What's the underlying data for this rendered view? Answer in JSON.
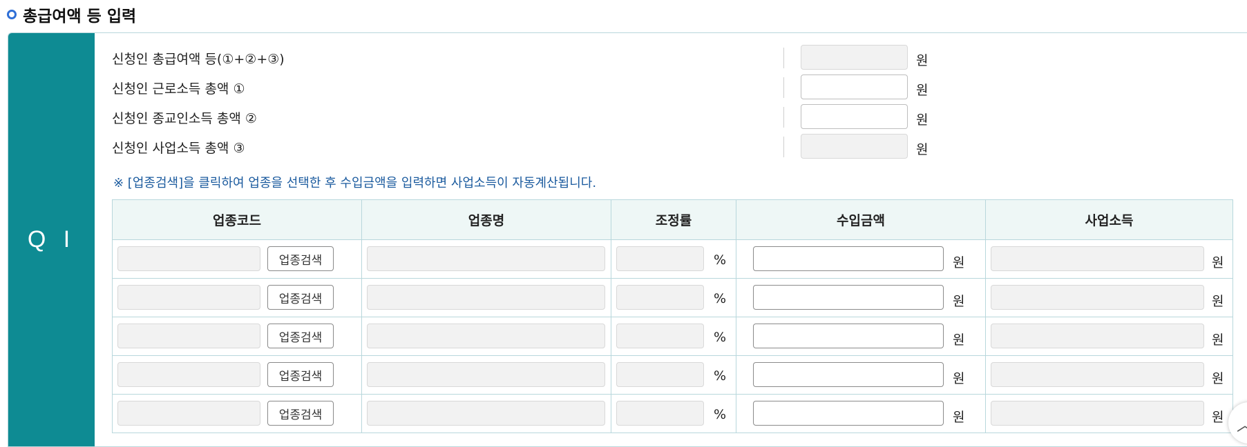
{
  "section": {
    "title": "총급여액 등 입력"
  },
  "side_label": "Q I",
  "income_rows": [
    {
      "label": "신청인 총급여액 등(①+②+③)",
      "value": "",
      "readonly": true,
      "unit": "원"
    },
    {
      "label": "신청인 근로소득 총액 ①",
      "value": "",
      "readonly": false,
      "unit": "원"
    },
    {
      "label": "신청인 종교인소득 총액 ②",
      "value": "",
      "readonly": false,
      "unit": "원"
    },
    {
      "label": "신청인 사업소득 총액 ③",
      "value": "",
      "readonly": true,
      "unit": "원"
    }
  ],
  "notice": "※ [업종검색]을 클릭하여 업종을 선택한 후 수입금액을 입력하면 사업소득이 자동계산됩니다.",
  "table": {
    "headers": [
      "업종코드",
      "업종명",
      "조정률",
      "수입금액",
      "사업소득"
    ],
    "search_button_label": "업종검색",
    "percent_unit": "%",
    "won_unit": "원",
    "rows": [
      {
        "code": "",
        "name": "",
        "rate": "",
        "income": "",
        "business_income": ""
      },
      {
        "code": "",
        "name": "",
        "rate": "",
        "income": "",
        "business_income": ""
      },
      {
        "code": "",
        "name": "",
        "rate": "",
        "income": "",
        "business_income": ""
      },
      {
        "code": "",
        "name": "",
        "rate": "",
        "income": "",
        "business_income": ""
      },
      {
        "code": "",
        "name": "",
        "rate": "",
        "income": "",
        "business_income": ""
      }
    ]
  },
  "scroll_top_icon": "chevron-up-icon"
}
